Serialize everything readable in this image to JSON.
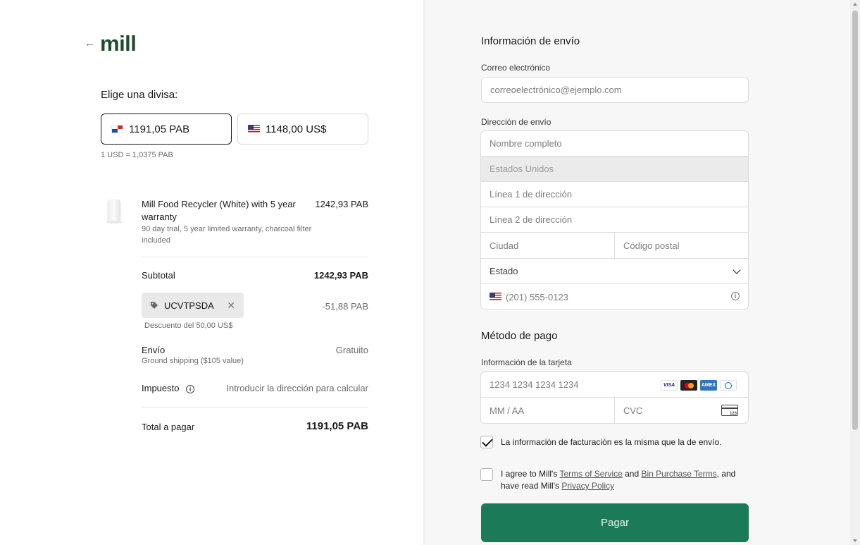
{
  "brand": {
    "logo_text": "mill",
    "back_icon": "arrow-left-icon"
  },
  "currency": {
    "title": "Elige una divisa:",
    "options": [
      {
        "label": "1191,05 PAB",
        "flag": "panama-flag-icon",
        "selected": true
      },
      {
        "label": "1148,00 US$",
        "flag": "us-flag-icon",
        "selected": false
      }
    ],
    "rate": "1 USD = 1,0375 PAB"
  },
  "order": {
    "product": {
      "name": "Mill Food Recycler (White) with 5 year warranty",
      "price": "1242,93 PAB",
      "description": "90 day trial, 5 year limited warranty, charcoal filter included"
    },
    "subtotal_label": "Subtotal",
    "subtotal_value": "1242,93 PAB",
    "coupon_code": "UCVTPSDA",
    "coupon_value": "-51,88 PAB",
    "discount_note": "Descuento del 50,00 US$",
    "shipping_label": "Envío",
    "shipping_value": "Gratuito",
    "shipping_note": "Ground shipping ($105 value)",
    "tax_label": "Impuesto",
    "tax_value": "Introducir la dirección para calcular",
    "total_label": "Total a pagar",
    "total_value": "1191,05 PAB"
  },
  "shipping_form": {
    "title": "Información de envío",
    "email_label": "Correo electrónico",
    "email_placeholder": "correoelectrónico@ejemplo.com",
    "address_label": "Dirección de envío",
    "full_name": "Nombre completo",
    "country": "Estados Unidos",
    "line1": "Línea 1 de dirección",
    "line2": "Línea 2 de dirección",
    "city": "Ciudad",
    "postal": "Código postal",
    "state": "Estado",
    "phone": "(201) 555-0123"
  },
  "payment": {
    "title": "Método de pago",
    "card_label": "Información de la tarjeta",
    "card_number": "1234 1234 1234 1234",
    "expiry": "MM / AA",
    "cvc": "CVC",
    "brands": [
      "VISA",
      "mastercard",
      "AMEX",
      "diners"
    ],
    "billing_same": "La información de facturación es la misma que la de envío.",
    "billing_same_checked": true,
    "agree_prefix": "I agree to Mill's ",
    "tos": "Terms of Service",
    "and": " and ",
    "bin_terms": "Bin Purchase Terms",
    "agree_mid": ", and have read Mill's ",
    "privacy": "Privacy Policy",
    "agree_checked": false,
    "pay_button": "Pagar"
  },
  "colors": {
    "brand_green": "#1f4d2b",
    "pay_button": "#1b7a57"
  }
}
